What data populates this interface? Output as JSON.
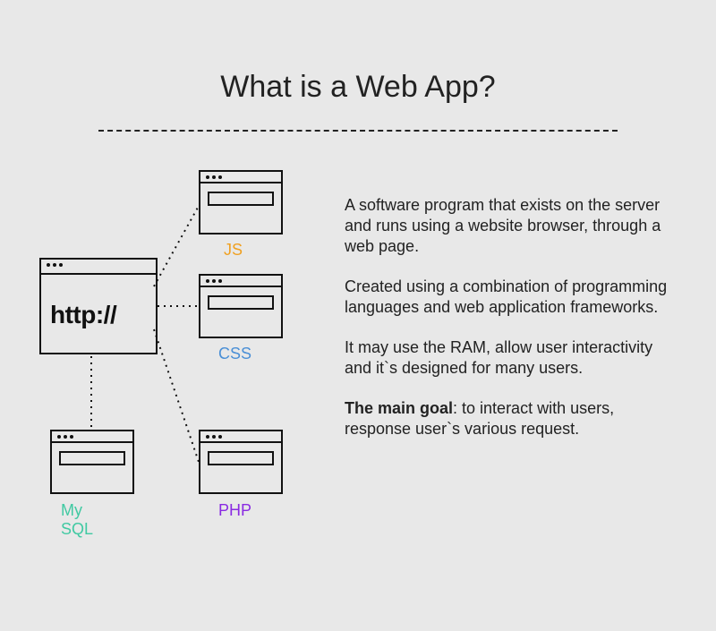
{
  "title": "What is a Web App?",
  "main_browser_text": "http://",
  "nodes": {
    "js": {
      "label": "JS",
      "color": "#f0a020"
    },
    "css": {
      "label": "CSS",
      "color": "#4a8fd6"
    },
    "php": {
      "label": "PHP",
      "color": "#8a2be2"
    },
    "mysql": {
      "label": "My SQL",
      "color": "#40c9a2"
    }
  },
  "paragraphs": {
    "p1": "A software program that exists on the server and runs using a website browser, through a web page.",
    "p2": "Created using a combination of programming languages and web application frameworks.",
    "p3": "It may use the RAM, allow user interactivity and it`s designed for many users.",
    "p4_bold": "The main goal",
    "p4_rest": ": to interact with users, response user`s various request."
  }
}
